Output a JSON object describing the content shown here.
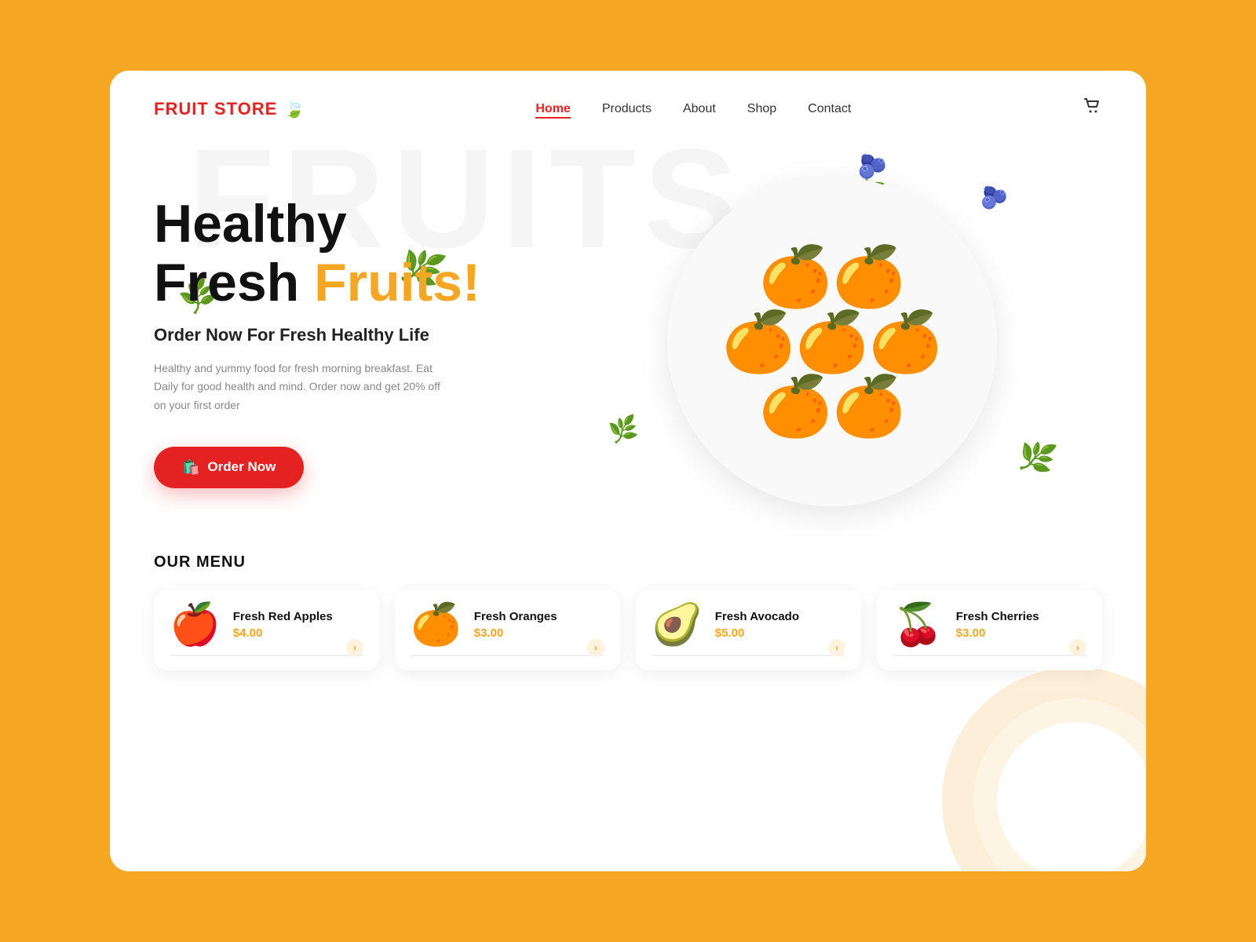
{
  "brand": {
    "name": "FRUIT STORE",
    "leaf_icon": "🍃"
  },
  "nav": {
    "links": [
      {
        "id": "home",
        "label": "Home",
        "active": true
      },
      {
        "id": "products",
        "label": "Products",
        "active": false
      },
      {
        "id": "about",
        "label": "About",
        "active": false
      },
      {
        "id": "shop",
        "label": "Shop",
        "active": false
      },
      {
        "id": "contact",
        "label": "Contact",
        "active": false
      }
    ],
    "cart_icon": "🛒"
  },
  "hero": {
    "heading_line1": "Healthy",
    "heading_line2_normal": "Fresh ",
    "heading_line2_highlight": "Fruits!",
    "subheading": "Order Now For Fresh Healthy Life",
    "description": "Healthy and yummy food for fresh morning breakfast. Eat Daily for good health and mind. Order now and get 20% off on your first order",
    "cta_label": "Order Now",
    "bg_text": "FRUITS"
  },
  "menu": {
    "section_title": "OUR MENU",
    "items": [
      {
        "id": "apples",
        "name": "Fresh Red Apples",
        "price": "$4.00",
        "icon": "🍎"
      },
      {
        "id": "oranges",
        "name": "Fresh Oranges",
        "price": "$3.00",
        "icon": "🍊"
      },
      {
        "id": "avocado",
        "name": "Fresh Avocado",
        "price": "$5.00",
        "icon": "🥑"
      },
      {
        "id": "cherries",
        "name": "Fresh Cherries",
        "price": "$3.00",
        "icon": "🍒"
      }
    ]
  },
  "colors": {
    "primary": "#E52222",
    "accent": "#F5A623",
    "text_dark": "#111111",
    "text_muted": "#888888",
    "bg_card": "#ffffff",
    "bg_outer": "#F5A623"
  }
}
